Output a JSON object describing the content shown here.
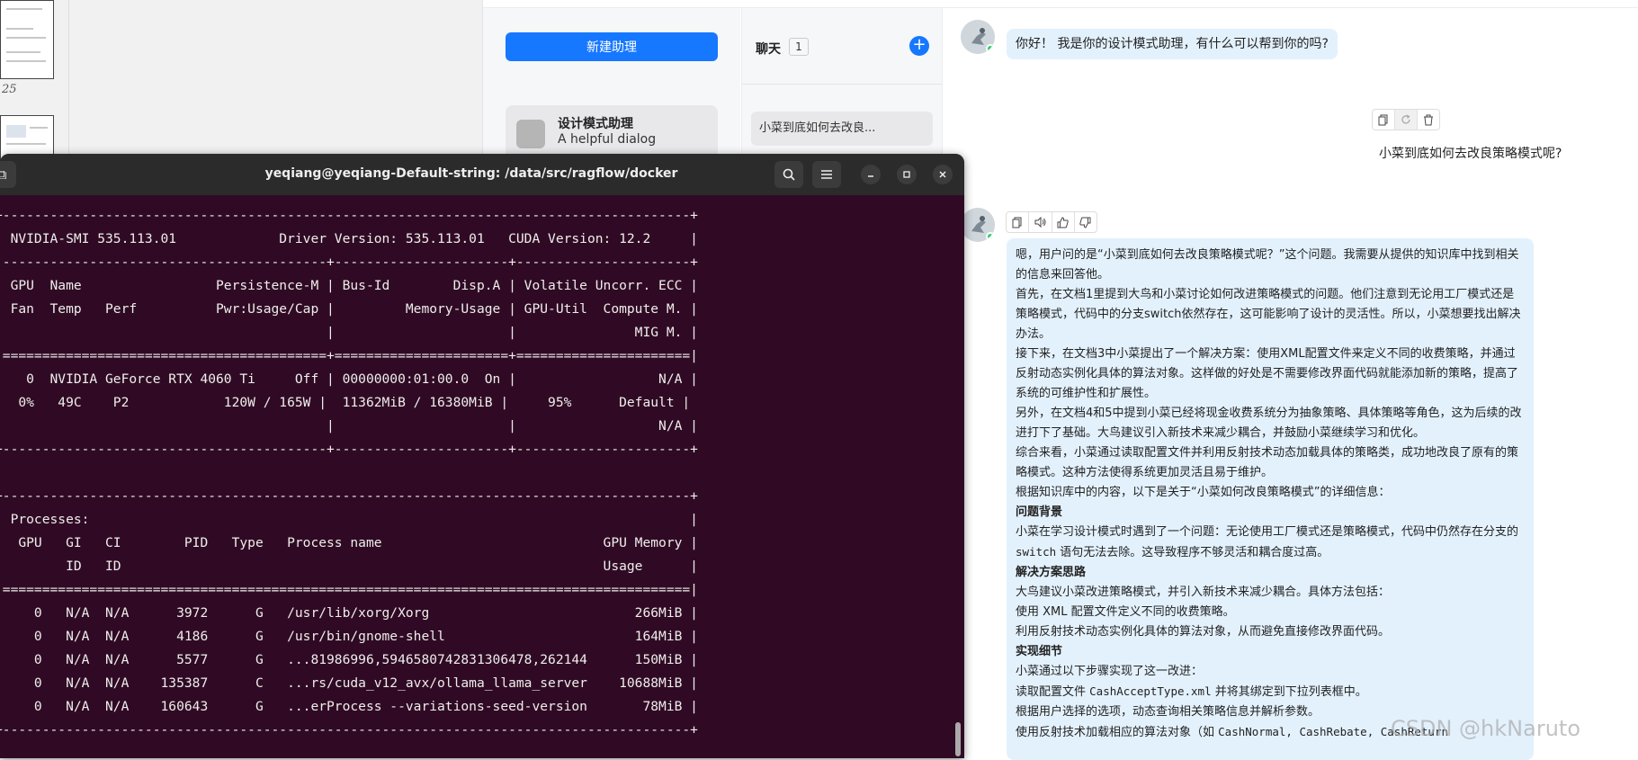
{
  "docviewer": {
    "page_number": "25"
  },
  "sidebar": {
    "new_assistant_label": "新建助理"
  },
  "assistant": {
    "name": "设计模式助理",
    "description": "A helpful dialog"
  },
  "chats": {
    "title": "聊天",
    "count": "1",
    "add_icon": "plus-circle-icon",
    "items": [
      "小菜到底如何去改良..."
    ]
  },
  "conversation": {
    "greeting": "你好！ 我是你的设计模式助理，有什么可以帮到你的吗?",
    "user_question": "小菜到底如何去改良策略模式呢?",
    "user_tools": [
      "copy-icon",
      "regenerate-icon",
      "delete-icon"
    ],
    "bot_tools": [
      "copy-icon",
      "speaker-icon",
      "thumbs-up-icon",
      "thumbs-down-icon"
    ],
    "answer": {
      "p1": "嗯，用户问的是“小菜到底如何去改良策略模式呢？”这个问题。我需要从提供的知识库中找到相关的信息来回答他。",
      "p2": "首先，在文档1里提到大鸟和小菜讨论如何改进策略模式的问题。他们注意到无论用工厂模式还是策略模式，代码中的分支switch依然存在，这可能影响了设计的灵活性。所以，小菜想要找出解决办法。",
      "p3": "接下来，在文档3中小菜提出了一个解决方案：使用XML配置文件来定义不同的收费策略，并通过反射动态实例化具体的算法对象。这样做的好处是不需要修改界面代码就能添加新的策略，提高了系统的可维护性和扩展性。",
      "p4": "另外，在文档4和5中提到小菜已经将现金收费系统分为抽象策略、具体策略等角色，这为后续的改进打下了基础。大鸟建议引入新技术来减少耦合，并鼓励小菜继续学习和优化。",
      "p5": "综合来看，小菜通过读取配置文件并利用反射技术动态加载具体的策略类，成功地改良了原有的策略模式。这种方法使得系统更加灵活且易于维护。",
      "p6": "根据知识库中的内容，以下是关于“小菜如何改良策略模式”的详细信息：",
      "h1": "问题背景",
      "p7a": "小菜在学习设计模式时遇到了一个问题：无论使用工厂模式还是策略模式，代码中仍然存在分支的 ",
      "p7code": "switch",
      "p7b": " 语句无法去除。这导致程序不够灵活和耦合度过高。",
      "h2": "解决方案思路",
      "p8": "大鸟建议小菜改进策略模式，并引入新技术来减少耦合。具体方法包括：",
      "p9": "使用 XML 配置文件定义不同的收费策略。",
      "p10": "利用反射技术动态实例化具体的算法对象，从而避免直接修改界面代码。",
      "h3": "实现细节",
      "p11": "小菜通过以下步骤实现了这一改进：",
      "p12a": "读取配置文件 ",
      "p12code": "CashAcceptType.xml",
      "p12b": " 并将其绑定到下拉列表框中。",
      "p13": "根据用户选择的选项，动态查询相关策略信息并解析参数。",
      "p14a": "使用反射技术加载相应的算法对象（如 ",
      "p14code": "CashNormal, CashRebate, CashReturn",
      "p14b": ""
    }
  },
  "watermark": "CSDN @hkNaruto",
  "terminal": {
    "title": "yeqiang@yeqiang-Default-string: /data/src/ragflow/docker",
    "search_icon": "search-icon",
    "menu_icon": "hamburger-menu-icon",
    "lines": [
      "+---------------------------------------------------------------------------------------+",
      "| NVIDIA-SMI 535.113.01             Driver Version: 535.113.01   CUDA Version: 12.2     |",
      "|-----------------------------------------+----------------------+----------------------+",
      "| GPU  Name                 Persistence-M | Bus-Id        Disp.A | Volatile Uncorr. ECC |",
      "| Fan  Temp   Perf          Pwr:Usage/Cap |         Memory-Usage | GPU-Util  Compute M. |",
      "|                                         |                      |               MIG M. |",
      "|=========================================+======================+======================|",
      "|   0  NVIDIA GeForce RTX 4060 Ti     Off | 00000000:01:00.0  On |                  N/A |",
      "|  0%   49C    P2            120W / 165W |  11362MiB / 16380MiB |     95%      Default |",
      "|                                         |                      |                  N/A |",
      "+-----------------------------------------+----------------------+----------------------+",
      "",
      "+---------------------------------------------------------------------------------------+",
      "| Processes:                                                                            |",
      "|  GPU   GI   CI        PID   Type   Process name                            GPU Memory |",
      "|        ID   ID                                                             Usage      |",
      "|=======================================================================================|",
      "|    0   N/A  N/A      3972      G   /usr/lib/xorg/Xorg                          266MiB |",
      "|    0   N/A  N/A      4186      G   /usr/bin/gnome-shell                        164MiB |",
      "|    0   N/A  N/A      5577      G   ...81986996,5946580742831306478,262144      150MiB |",
      "|    0   N/A  N/A    135387      C   ...rs/cuda_v12_avx/ollama_llama_server    10688MiB |",
      "|    0   N/A  N/A    160643      G   ...erProcess --variations-seed-version       78MiB |",
      "+---------------------------------------------------------------------------------------+"
    ]
  }
}
